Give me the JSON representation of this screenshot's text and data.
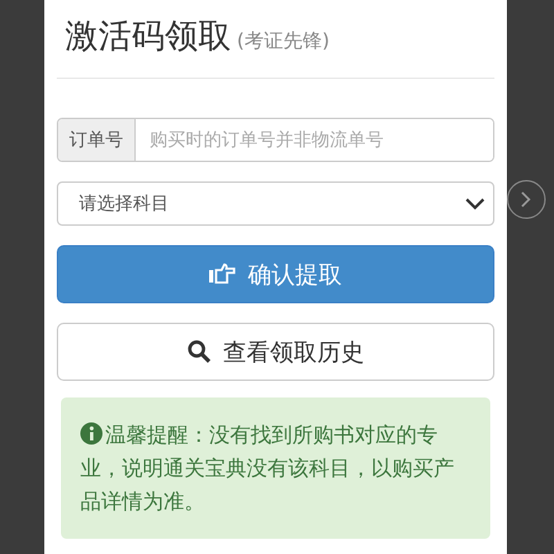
{
  "dialog": {
    "title": "激活码领取",
    "subtitle": "(考证先锋)"
  },
  "order_field": {
    "label": "订单号",
    "placeholder": "购买时的订单号并非物流单号"
  },
  "subject_select": {
    "placeholder": "请选择科目"
  },
  "buttons": [
    {
      "kind": "primary",
      "label": "确认提取"
    },
    {
      "kind": "default",
      "label": "查看领取历史"
    }
  ],
  "notice": {
    "text": "温馨提醒：没有找到所购书对应的专业，说明通关宝典没有该科目，以购买产品详情为准。"
  }
}
